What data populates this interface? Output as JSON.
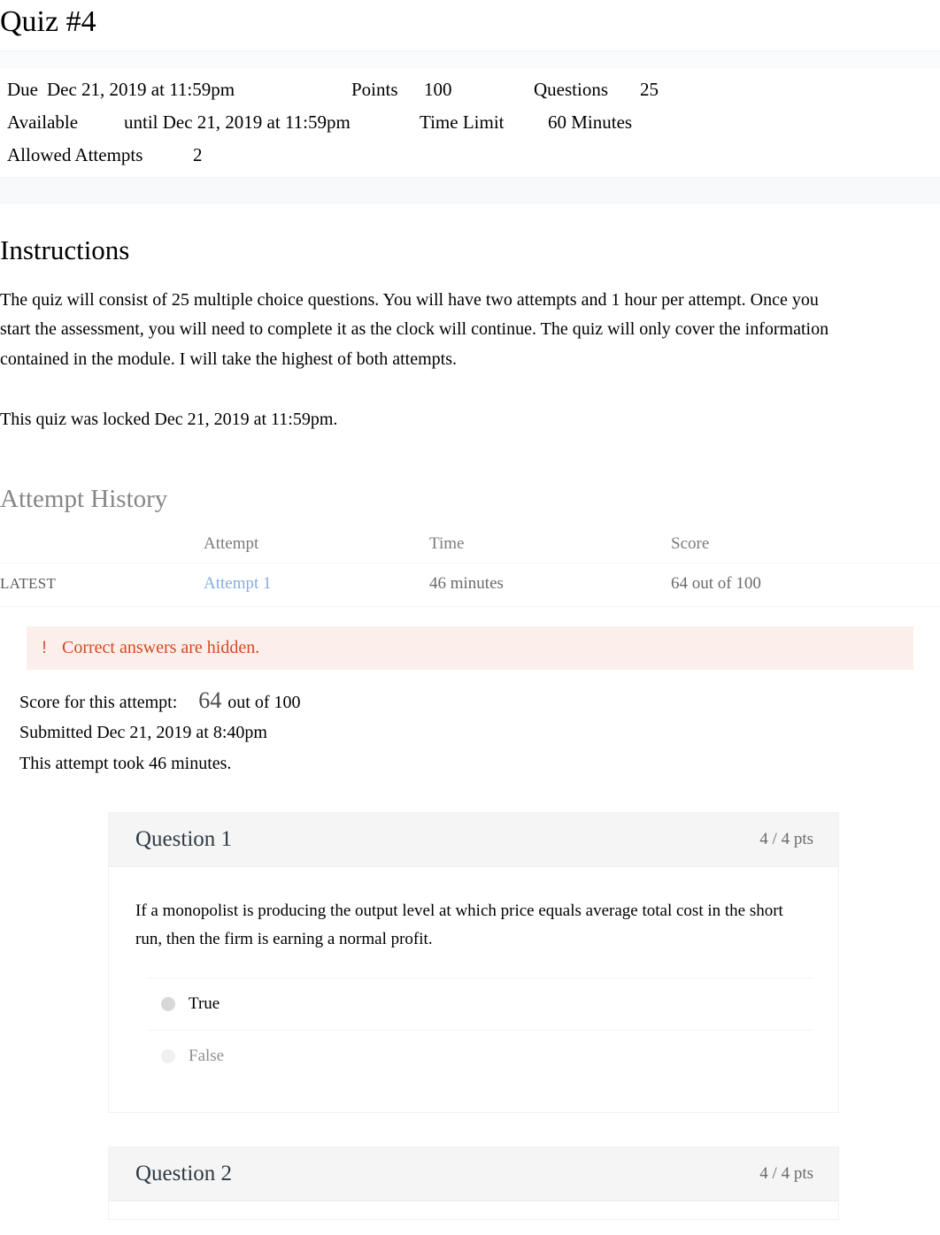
{
  "quiz": {
    "title": "Quiz #4",
    "meta": {
      "due_label": "Due",
      "due_value": "Dec 21, 2019 at 11:59pm",
      "points_label": "Points",
      "points_value": "100",
      "questions_label": "Questions",
      "questions_value": "25",
      "available_label": "Available",
      "available_value": "until Dec 21, 2019 at 11:59pm",
      "time_limit_label": "Time Limit",
      "time_limit_value": "60 Minutes",
      "allowed_attempts_label": "Allowed Attempts",
      "allowed_attempts_value": "2"
    }
  },
  "instructions": {
    "heading": "Instructions",
    "paragraph": "The quiz will consist of 25 multiple choice questions. You will have two attempts and 1 hour per attempt. Once you start the assessment, you will need to complete it as the clock will continue. The quiz will only cover the information contained in the module. I will take the highest of both attempts.",
    "locked_note": "This quiz was locked Dec 21, 2019 at 11:59pm."
  },
  "attempt_history": {
    "heading": "Attempt History",
    "columns": {
      "kept": "",
      "attempt": "Attempt",
      "time": "Time",
      "score": "Score"
    },
    "rows": [
      {
        "kept": "LATEST",
        "attempt": "Attempt 1",
        "time": "46 minutes",
        "score": "64 out of 100"
      }
    ]
  },
  "banner": {
    "icon": "warning-icon",
    "icon_glyph": "!",
    "text": "Correct answers are hidden.",
    "text_color": "#d04a22",
    "background_color": "#fcefeb"
  },
  "attempt_summary": {
    "score_label": "Score for this attempt:",
    "score_number": "64",
    "score_suffix": "out of 100",
    "submitted": "Submitted Dec 21, 2019 at 8:40pm",
    "duration": "This attempt took 46 minutes."
  },
  "questions": [
    {
      "name": "Question 1",
      "points": "4 / 4 pts",
      "text": "If a monopolist is producing the output level at which price equals average total cost in the short run, then the firm is earning a normal profit.",
      "answers": [
        {
          "label": "True",
          "selected": true
        },
        {
          "label": "False",
          "selected": false
        }
      ]
    },
    {
      "name": "Question 2",
      "points": "4 / 4 pts",
      "text": "",
      "answers": []
    }
  ],
  "colors": {
    "link": "#85ade0",
    "muted_heading": "#868686",
    "warning": "#d04a22",
    "card_header_bg": "#f5f5f5"
  }
}
